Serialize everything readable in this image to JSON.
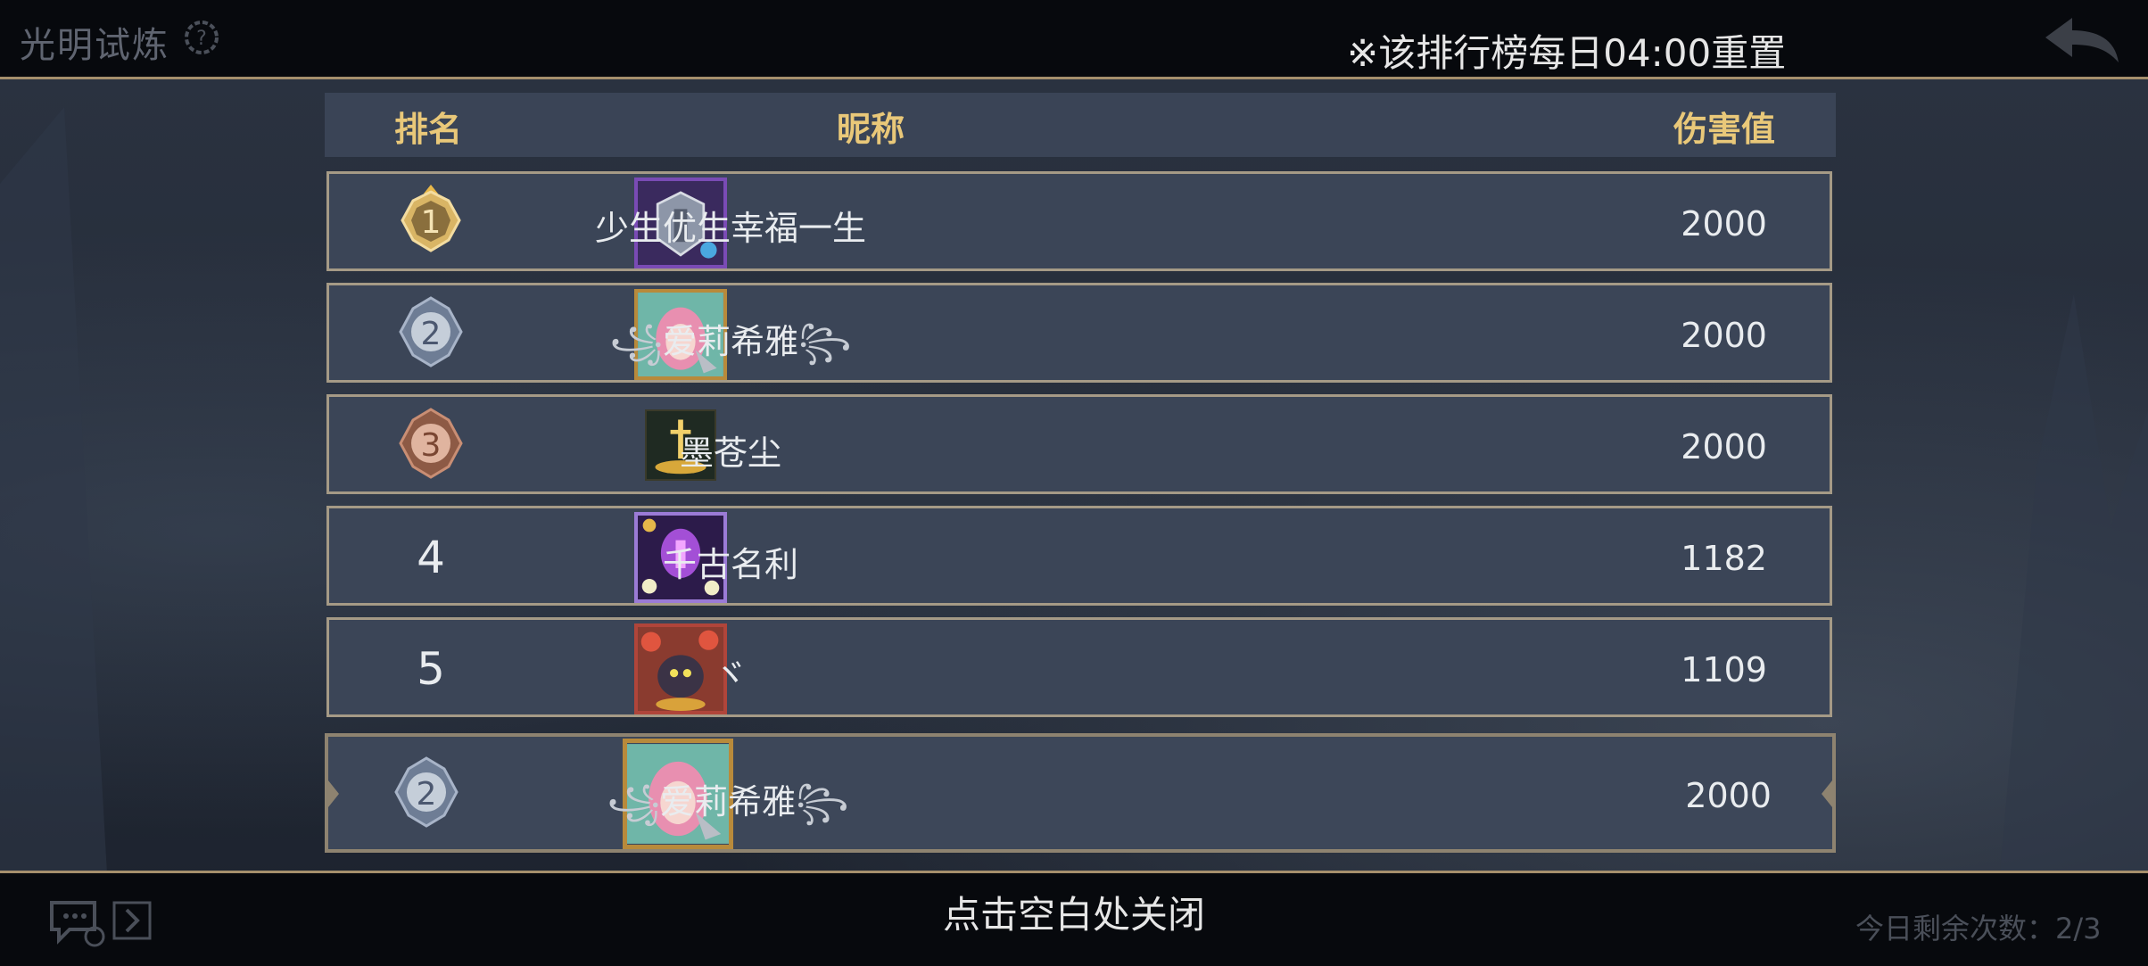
{
  "header": {
    "title": "光明试炼",
    "reset_note": "※该排行榜每日04:00重置"
  },
  "table": {
    "columns": {
      "rank": "排名",
      "nickname": "昵称",
      "damage": "伤害值"
    },
    "rows": [
      {
        "rank": "1",
        "name": "少生优生幸福一生",
        "damage": "2000"
      },
      {
        "rank": "2",
        "name": "爱莉希雅",
        "damage": "2000"
      },
      {
        "rank": "3",
        "name": "墨苍尘",
        "damage": "2000"
      },
      {
        "rank": "4",
        "name": "千古名利",
        "damage": "1182"
      },
      {
        "rank": "5",
        "name": "ヾ",
        "damage": "1109"
      }
    ],
    "self": {
      "rank": "2",
      "name": "爱莉希雅",
      "damage": "2000"
    }
  },
  "footer": {
    "close_hint": "点击空白处关闭",
    "remaining": "今日剩余次数：2/3"
  },
  "colors": {
    "gold_text": "#e9c879",
    "row_bg": "#3b4557",
    "frame_gold": "#a58f6c"
  },
  "icons": {
    "help": "help-gear-icon",
    "back": "back-arrow-icon",
    "chat": "chat-icon",
    "expand": "chevron-right-icon"
  }
}
